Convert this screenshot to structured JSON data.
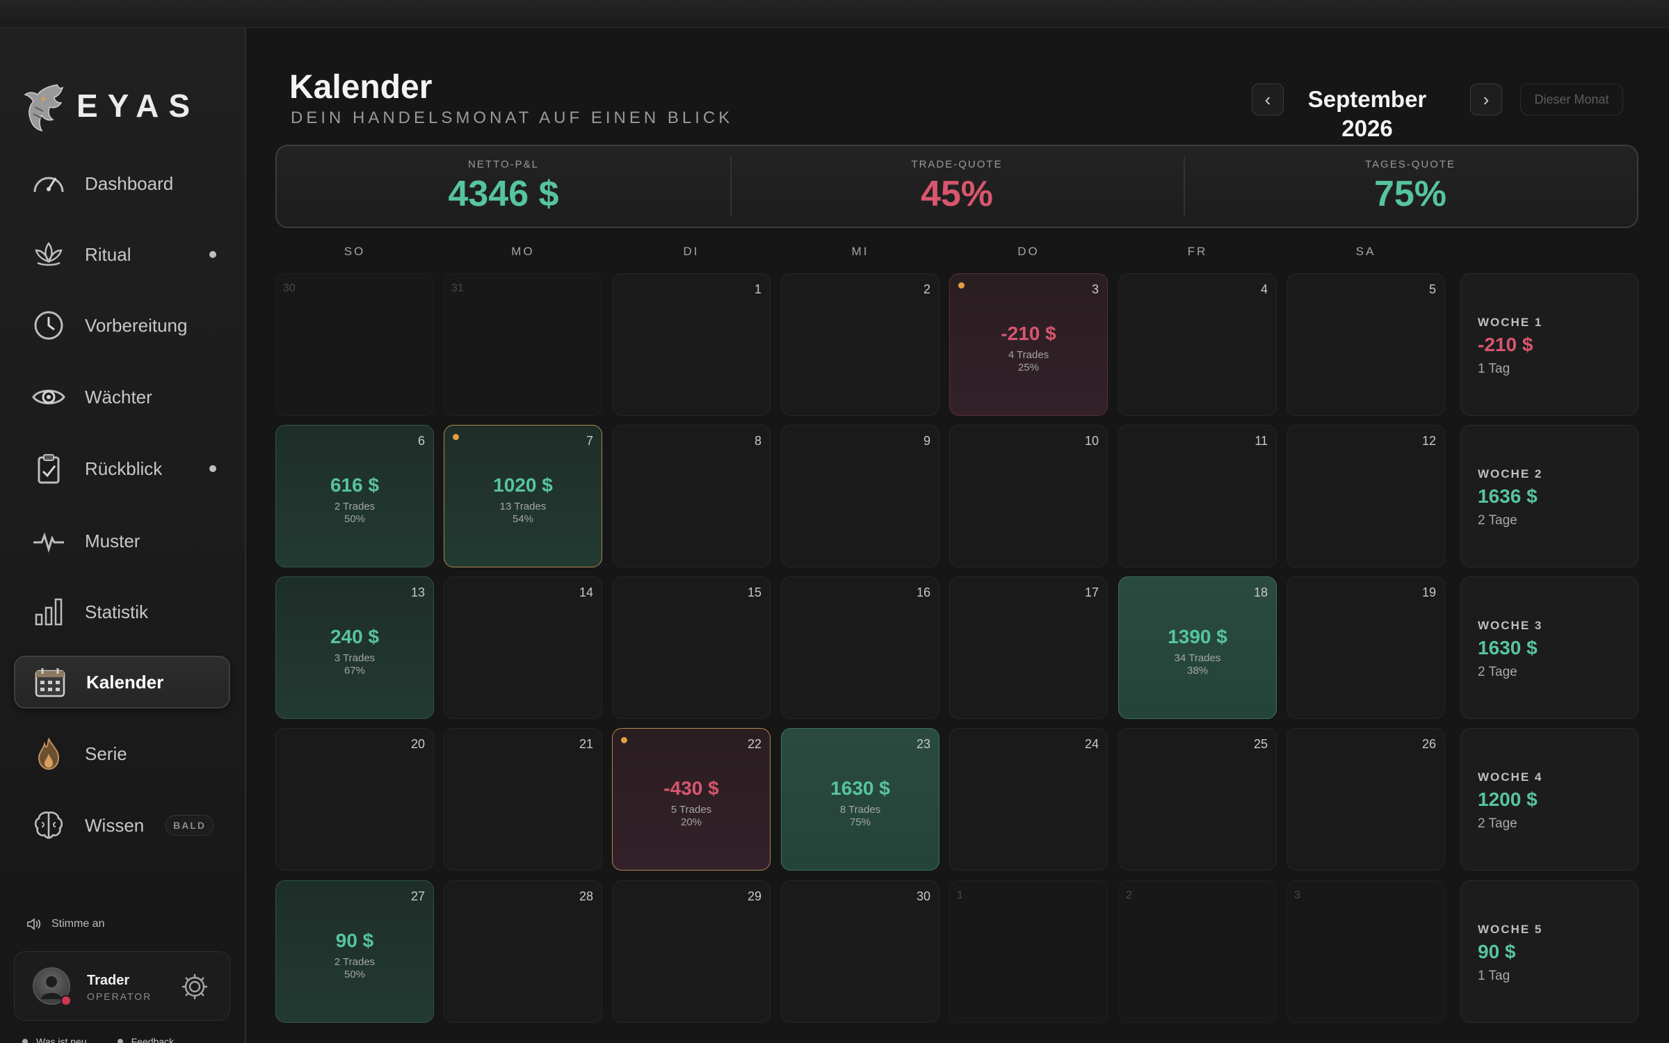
{
  "brand": {
    "name": "EYAS",
    "logo_icon": "eagle-icon"
  },
  "sidebar": {
    "items": [
      {
        "label": "Dashboard",
        "icon": "speedometer-icon",
        "dot": false
      },
      {
        "label": "Ritual",
        "icon": "lotus-icon",
        "dot": true
      },
      {
        "label": "Vorbereitung",
        "icon": "clock-icon",
        "dot": false
      },
      {
        "label": "Wächter",
        "icon": "eye-icon",
        "dot": false
      },
      {
        "label": "Rückblick",
        "icon": "clipboard-check-icon",
        "dot": true
      },
      {
        "label": "Muster",
        "icon": "pulse-icon",
        "dot": false
      },
      {
        "label": "Statistik",
        "icon": "bar-chart-icon",
        "dot": false
      },
      {
        "label": "Kalender",
        "icon": "calendar-icon",
        "dot": false,
        "active": true
      },
      {
        "label": "Serie",
        "icon": "flame-icon",
        "dot": false
      },
      {
        "label": "Wissen",
        "icon": "brain-icon",
        "dot": false,
        "badge": "BALD"
      }
    ],
    "voice_label": "Stimme an",
    "user": {
      "name": "Trader",
      "role": "OPERATOR"
    },
    "footer": {
      "whats_new": "Was ist neu",
      "feedback": "Feedback"
    }
  },
  "header": {
    "title": "Kalender",
    "subtitle": "DEIN HANDELSMONAT AUF EINEN BLICK",
    "month": "September 2026",
    "this_month": "Dieser Monat",
    "prev": "‹",
    "next": "›"
  },
  "stats": [
    {
      "label": "NETTO-P&L",
      "value": "4346 $",
      "tone": "pos"
    },
    {
      "label": "TRADE-QUOTE",
      "value": "45%",
      "tone": "neg"
    },
    {
      "label": "TAGES-QUOTE",
      "value": "75%",
      "tone": "pos"
    }
  ],
  "weekdays": [
    "SO",
    "MO",
    "DI",
    "MI",
    "DO",
    "FR",
    "SA"
  ],
  "weeks": [
    {
      "days": [
        {
          "d": "30",
          "out": true
        },
        {
          "d": "31",
          "out": true
        },
        {
          "d": "1"
        },
        {
          "d": "2"
        },
        {
          "d": "3",
          "pnl": "-210 $",
          "trades": "4 Trades",
          "pct": "25%",
          "tone": "loss",
          "mark": true
        },
        {
          "d": "4"
        },
        {
          "d": "5"
        }
      ],
      "summary": {
        "label": "WOCHE 1",
        "value": "-210 $",
        "days": "1 Tag",
        "tone": "neg"
      }
    },
    {
      "days": [
        {
          "d": "6",
          "pnl": "616 $",
          "trades": "2 Trades",
          "pct": "50%",
          "tone": "win"
        },
        {
          "d": "7",
          "pnl": "1020 $",
          "trades": "13 Trades",
          "pct": "54%",
          "tone": "win",
          "mark": true,
          "flag": true
        },
        {
          "d": "8"
        },
        {
          "d": "9"
        },
        {
          "d": "10"
        },
        {
          "d": "11"
        },
        {
          "d": "12"
        }
      ],
      "summary": {
        "label": "WOCHE 2",
        "value": "1636 $",
        "days": "2 Tage",
        "tone": "pos"
      }
    },
    {
      "days": [
        {
          "d": "13",
          "pnl": "240 $",
          "trades": "3 Trades",
          "pct": "67%",
          "tone": "win"
        },
        {
          "d": "14"
        },
        {
          "d": "15"
        },
        {
          "d": "16"
        },
        {
          "d": "17"
        },
        {
          "d": "18",
          "pnl": "1390 $",
          "trades": "34 Trades",
          "pct": "38%",
          "tone": "win",
          "bright": true
        },
        {
          "d": "19"
        }
      ],
      "summary": {
        "label": "WOCHE 3",
        "value": "1630 $",
        "days": "2 Tage",
        "tone": "pos"
      }
    },
    {
      "days": [
        {
          "d": "20"
        },
        {
          "d": "21"
        },
        {
          "d": "22",
          "pnl": "-430 $",
          "trades": "5 Trades",
          "pct": "20%",
          "tone": "loss",
          "mark": true,
          "flag": true
        },
        {
          "d": "23",
          "pnl": "1630 $",
          "trades": "8 Trades",
          "pct": "75%",
          "tone": "win",
          "bright": true
        },
        {
          "d": "24"
        },
        {
          "d": "25"
        },
        {
          "d": "26"
        }
      ],
      "summary": {
        "label": "WOCHE 4",
        "value": "1200 $",
        "days": "2 Tage",
        "tone": "pos"
      }
    },
    {
      "days": [
        {
          "d": "27",
          "pnl": "90 $",
          "trades": "2 Trades",
          "pct": "50%",
          "tone": "win"
        },
        {
          "d": "28"
        },
        {
          "d": "29"
        },
        {
          "d": "30"
        },
        {
          "d": "1",
          "out": true
        },
        {
          "d": "2",
          "out": true
        },
        {
          "d": "3",
          "out": true
        }
      ],
      "summary": {
        "label": "WOCHE 5",
        "value": "90 $",
        "days": "1 Tag",
        "tone": "pos"
      }
    }
  ],
  "colors": {
    "positive": "#57c4a0",
    "negative": "#d8566e",
    "accent_marker": "#e0a040"
  }
}
